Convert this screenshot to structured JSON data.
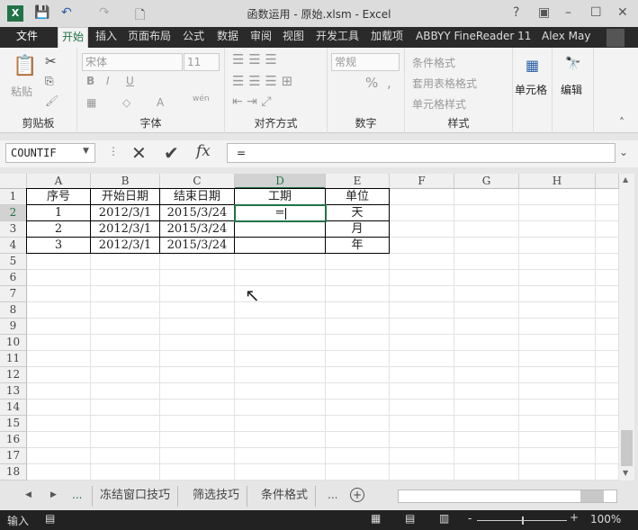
{
  "title": "函数运用 - 原始.xlsm - Excel",
  "window_controls": [
    "?",
    "restore-ribbon",
    "minimize",
    "maximize",
    "close"
  ],
  "tabs": [
    "文件",
    "开始",
    "插入",
    "页面布局",
    "公式",
    "数据",
    "审阅",
    "视图",
    "开发工具",
    "加载项",
    "ABBYY FineReader 11"
  ],
  "active_tab": "开始",
  "user": "Alex May",
  "ribbon": {
    "clipboard": {
      "label": "剪贴板",
      "paste": "粘贴"
    },
    "font": {
      "label": "字体",
      "font_name": "宋体",
      "font_size": "11",
      "bold": "B",
      "italic": "I",
      "underline": "U",
      "color": "A",
      "phonetic": "wén"
    },
    "alignment": {
      "label": "对齐方式"
    },
    "number": {
      "label": "数字",
      "format": "常规",
      "percent": "%",
      "comma": ","
    },
    "styles": {
      "label": "样式",
      "conditional": "条件格式",
      "table": "套用表格格式",
      "cell_styles": "单元格样式"
    },
    "cells": {
      "label": "单元格"
    },
    "editing": {
      "label": "编辑"
    }
  },
  "formula_bar": {
    "name_box": "COUNTIF",
    "fx": "fx",
    "value": "="
  },
  "columns": [
    "A",
    "B",
    "C",
    "D",
    "E",
    "F",
    "G",
    "H"
  ],
  "selected_column": "D",
  "rows": [
    "1",
    "2",
    "3",
    "4",
    "5",
    "6",
    "7",
    "8",
    "9",
    "10",
    "11",
    "12",
    "13",
    "14",
    "15",
    "16",
    "17",
    "18"
  ],
  "selected_row": "2",
  "table": {
    "header": [
      "序号",
      "开始日期",
      "结束日期",
      "工期",
      "单位"
    ],
    "rows": [
      [
        "1",
        "2012/3/1",
        "2015/3/24",
        "=",
        "天"
      ],
      [
        "2",
        "2012/3/1",
        "2015/3/24",
        "",
        "月"
      ],
      [
        "3",
        "2012/3/1",
        "2015/3/24",
        "",
        "年"
      ]
    ]
  },
  "sheet_tabs": [
    "冻结窗口技巧",
    "筛选技巧",
    "条件格式"
  ],
  "sheet_nav": {
    "more": "...",
    "add": "+"
  },
  "status": {
    "mode": "输入",
    "zoom": "100%",
    "zoom_level": 100
  },
  "accent": "#217346"
}
